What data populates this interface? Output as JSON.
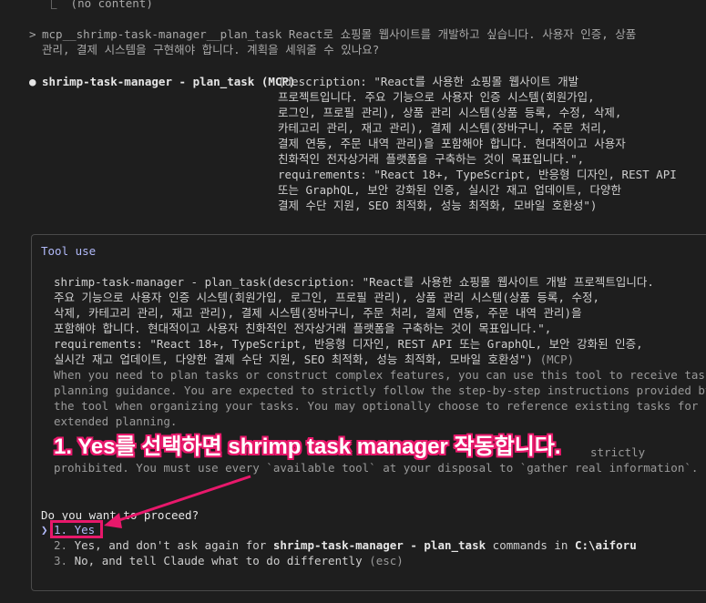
{
  "top_line": "⎿  (no content)",
  "prompt": {
    "marker": ">",
    "line1": "mcp__shrimp-task-manager__plan_task React로 쇼핑몰 웹사이트를 개발하고 싶습니다. 사용자 인증, 상품",
    "line2": "관리, 결제 시스템을 구현해야 합니다. 계획을 세워줄 수 있나요?"
  },
  "call": {
    "bullet": "●",
    "name": "shrimp-task-manager - plan_task (MCP)",
    "lines": [
      "(description: \"React를 사용한 쇼핑몰 웹사이트 개발",
      "프로젝트입니다. 주요 기능으로 사용자 인증 시스템(회원가입,",
      "로그인, 프로필 관리), 상품 관리 시스템(상품 등록, 수정, 삭제,",
      "카테고리 관리, 재고 관리), 결제 시스템(장바구니, 주문 처리,",
      "결제 연동, 주문 내역 관리)을 포함해야 합니다. 현대적이고 사용자",
      "친화적인 전자상거래 플랫폼을 구축하는 것이 목표입니다.\",",
      "requirements: \"React 18+, TypeScript, 반응형 디자인, REST API",
      "또는 GraphQL, 보안 강화된 인증, 실시간 재고 업데이트, 다양한",
      "결제 수단 지원, SEO 최적화, 성능 최적화, 모바일 호환성\")"
    ]
  },
  "tool_use": {
    "title": "Tool use",
    "detail_lines": [
      "shrimp-task-manager - plan_task(description: \"React를 사용한 쇼핑몰 웹사이트 개발 프로젝트입니다.",
      "주요 기능으로 사용자 인증 시스템(회원가입, 로그인, 프로필 관리), 상품 관리 시스템(상품 등록, 수정,",
      "삭제, 카테고리 관리, 재고 관리), 결제 시스템(장바구니, 주문 처리, 결제 연동, 주문 내역 관리)을",
      "포함해야 합니다. 현대적이고 사용자 친화적인 전자상거래 플랫폼을 구축하는 것이 목표입니다.\",",
      "requirements: \"React 18+, TypeScript, 반응형 디자인, REST API 또는 GraphQL, 보안 강화된 인증,",
      "실시간 재고 업데이트, 다양한 결제 수단 지원, SEO 최적화, 성능 최적화, 모바일 호환성\")"
    ],
    "mcp_tag": " (MCP)",
    "desc_lines": [
      "When you need to plan tasks or construct complex features, you can use this tool to receive task",
      "planning guidance. You are expected to strictly follow the step-by-step instructions provided by",
      "the tool when organizing your tasks. You may optionally choose to reference existing tasks for",
      "extended planning."
    ],
    "hidden_line_tail": "strictly",
    "desc_line_last": "prohibited. You must use every `available tool` at your disposal to `gather real information`.",
    "question": "Do you want to proceed?",
    "cursor": "❯",
    "options": [
      {
        "number": "1.",
        "text": "Yes"
      },
      {
        "number": "2.",
        "text_before": "Yes, and don't ask again for ",
        "bold": "shrimp-task-manager - plan_task",
        "text_after": " commands in ",
        "path": "C:\\aiforu"
      },
      {
        "number": "3.",
        "text": "No, and tell Claude what to do differently ",
        "hint": "(esc)"
      }
    ]
  },
  "annotation": {
    "text": "1. Yes를 선택하면 shrimp task manager 작동합니다.",
    "color": "#e8186b"
  }
}
